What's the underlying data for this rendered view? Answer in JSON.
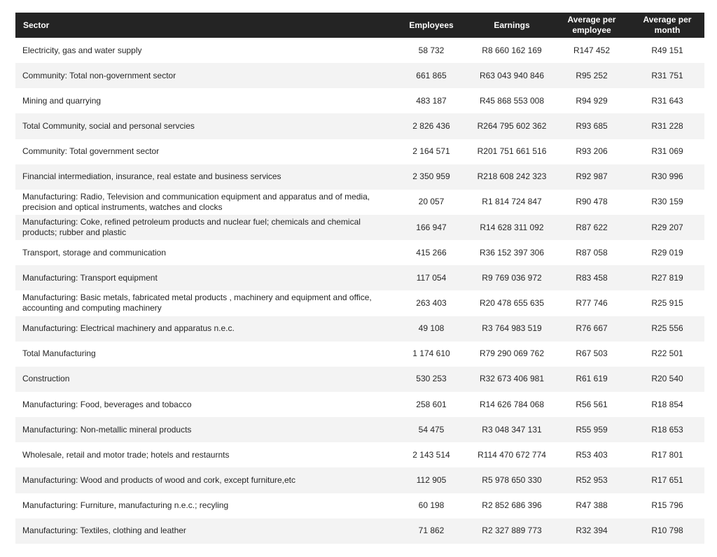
{
  "table": {
    "headers": {
      "sector": "Sector",
      "employees": "Employees",
      "earnings": "Earnings",
      "avg_employee": "Average per employee",
      "avg_month": "Average per month"
    },
    "rows": [
      {
        "sector": "Electricity, gas and water supply",
        "employees": "58 732",
        "earnings": "R8 660 162 169",
        "avg_employee": "R147 452",
        "avg_month": "R49 151"
      },
      {
        "sector": "Community: Total non-government sector",
        "employees": "661 865",
        "earnings": "R63 043 940 846",
        "avg_employee": "R95 252",
        "avg_month": "R31 751"
      },
      {
        "sector": "Mining and quarrying",
        "employees": "483 187",
        "earnings": "R45 868 553 008",
        "avg_employee": "R94 929",
        "avg_month": "R31 643"
      },
      {
        "sector": "Total Community, social and personal servcies",
        "employees": "2 826 436",
        "earnings": "R264 795 602 362",
        "avg_employee": "R93 685",
        "avg_month": "R31 228"
      },
      {
        "sector": "Community: Total government sector",
        "employees": "2 164 571",
        "earnings": "R201 751 661 516",
        "avg_employee": "R93 206",
        "avg_month": "R31 069"
      },
      {
        "sector": "Financial intermediation, insurance, real estate and business services",
        "employees": "2 350 959",
        "earnings": "R218 608 242 323",
        "avg_employee": "R92 987",
        "avg_month": "R30 996"
      },
      {
        "sector": "Manufacturing: Radio, Television and communication equipment and apparatus and of media, precision and optical instruments, watches and clocks",
        "employees": "20 057",
        "earnings": "R1 814 724 847",
        "avg_employee": "R90 478",
        "avg_month": "R30 159"
      },
      {
        "sector": "Manufacturing: Coke, refined petroleum products and nuclear fuel; chemicals and chemical products; rubber and plastic",
        "employees": "166 947",
        "earnings": "R14 628 311 092",
        "avg_employee": "R87 622",
        "avg_month": "R29 207"
      },
      {
        "sector": "Transport, storage and communication",
        "employees": "415 266",
        "earnings": "R36 152 397 306",
        "avg_employee": "R87 058",
        "avg_month": "R29 019"
      },
      {
        "sector": "Manufacturing: Transport equipment",
        "employees": "117 054",
        "earnings": "R9 769 036 972",
        "avg_employee": "R83 458",
        "avg_month": "R27 819"
      },
      {
        "sector": "Manufacturing: Basic metals, fabricated metal products , machinery and equipment and office, accounting and computing machinery",
        "employees": "263 403",
        "earnings": "R20 478 655 635",
        "avg_employee": "R77 746",
        "avg_month": "R25 915"
      },
      {
        "sector": "Manufacturing: Electrical machinery and apparatus n.e.c.",
        "employees": "49 108",
        "earnings": "R3 764 983 519",
        "avg_employee": "R76 667",
        "avg_month": "R25 556"
      },
      {
        "sector": "Total Manufacturing",
        "employees": "1 174 610",
        "earnings": "R79 290 069 762",
        "avg_employee": "R67 503",
        "avg_month": "R22 501"
      },
      {
        "sector": "Construction",
        "employees": "530 253",
        "earnings": "R32 673 406 981",
        "avg_employee": "R61 619",
        "avg_month": "R20 540"
      },
      {
        "sector": "Manufacturing: Food, beverages and tobacco",
        "employees": "258 601",
        "earnings": "R14 626 784 068",
        "avg_employee": "R56 561",
        "avg_month": "R18 854"
      },
      {
        "sector": "Manufacturing: Non-metallic mineral products",
        "employees": "54 475",
        "earnings": "R3 048 347 131",
        "avg_employee": "R55 959",
        "avg_month": "R18 653"
      },
      {
        "sector": "Wholesale, retail and motor  trade; hotels and restaurnts",
        "employees": "2 143 514",
        "earnings": "R114 470 672 774",
        "avg_employee": "R53 403",
        "avg_month": "R17 801"
      },
      {
        "sector": "Manufacturing: Wood and products of wood and cork, except furniture,etc",
        "employees": "112 905",
        "earnings": "R5 978 650 330",
        "avg_employee": "R52 953",
        "avg_month": "R17 651"
      },
      {
        "sector": "Manufacturing: Furniture, manufacturing n.e.c.; recyling",
        "employees": "60 198",
        "earnings": "R2 852 686 396",
        "avg_employee": "R47 388",
        "avg_month": "R15 796"
      },
      {
        "sector": "Manufacturing: Textiles, clothing and leather",
        "employees": "71 862",
        "earnings": "R2 327 889 773",
        "avg_employee": "R32 394",
        "avg_month": "R10 798"
      }
    ]
  },
  "colors": {
    "header_bg": "#242424",
    "header_text": "#ffffff",
    "row_alt_bg": "#f3f3f3",
    "row_bg": "#ffffff"
  }
}
